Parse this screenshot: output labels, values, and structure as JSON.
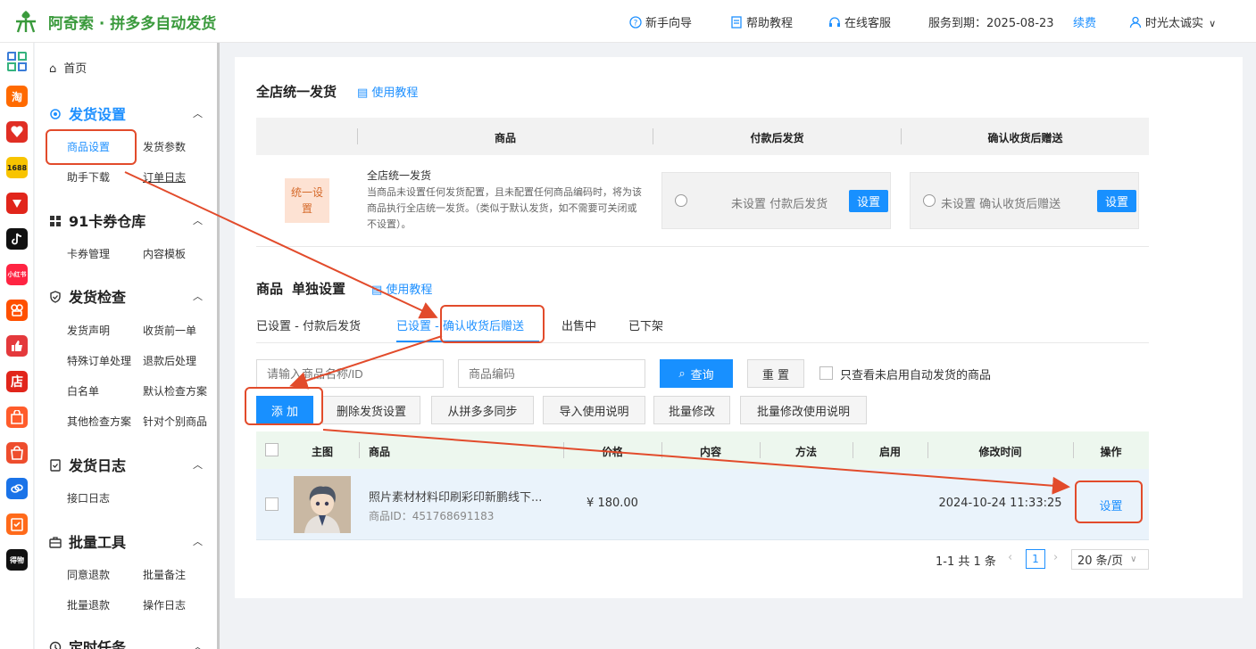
{
  "header": {
    "brand": "阿奇索 · 拼多多自动发货",
    "nav": [
      "新手向导",
      "帮助教程",
      "在线客服"
    ],
    "service_label": "服务到期：2025-08-23",
    "renew": "续费",
    "user": "时光太诚实"
  },
  "apps": [
    "淘",
    "",
    "",
    "",
    "",
    "小红书",
    "",
    "",
    "店",
    "",
    "",
    "",
    "",
    "得物"
  ],
  "sidebar": {
    "home": "首页",
    "sections": [
      {
        "title": "发货设置",
        "items": [
          "商品设置",
          "发货参数",
          "助手下载",
          "订单日志"
        ]
      },
      {
        "title": "91卡券仓库",
        "items": [
          "卡券管理",
          "内容模板"
        ]
      },
      {
        "title": "发货检查",
        "items": [
          "发货声明",
          "收货前一单",
          "特殊订单处理",
          "退款后处理",
          "白名单",
          "默认检查方案",
          "其他检查方案",
          "针对个别商品"
        ]
      },
      {
        "title": "发货日志",
        "items": [
          "接口日志"
        ]
      },
      {
        "title": "批量工具",
        "items": [
          "同意退款",
          "批量备注",
          "批量退款",
          "操作日志"
        ]
      },
      {
        "title": "定时任务",
        "items": []
      }
    ]
  },
  "store_section": {
    "title": "全店统一发货",
    "help": "使用教程",
    "columns": [
      "商品",
      "付款后发货",
      "确认收货后赠送"
    ],
    "badge": "统一设置",
    "row_title": "全店统一发货",
    "row_desc": "当商品未设置任何发货配置，且未配置任何商品编码时，将为该商品执行全店统一发货。（类似于默认发货，如不需要可关闭或不设置）。",
    "pay_status": "未设置 付款后发货",
    "confirm_status": "未设置 确认收货后赠送",
    "set_label": "设置"
  },
  "product_section": {
    "title_a": "商品",
    "title_b": "单独设置",
    "help": "使用教程",
    "tabs": [
      "已设置 - 付款后发货",
      "已设置 - 确认收货后赠送",
      "出售中",
      "已下架"
    ],
    "active_tab": "已设置 - 确认收货后赠送",
    "search_placeholder": "请输入商品名称/ID",
    "code_placeholder": "商品编码",
    "query": "查询",
    "reset": "重 置",
    "only_unenabled": "只查看未启用自动发货的商品",
    "actions": [
      "添 加",
      "删除发货设置",
      "从拼多多同步",
      "导入使用说明",
      "批量修改",
      "批量修改使用说明"
    ],
    "columns": [
      "主图",
      "商品",
      "价格",
      "内容",
      "方法",
      "启用",
      "修改时间",
      "操作"
    ],
    "rows": [
      {
        "name": "照片素材材料印刷彩印新鹏线下...",
        "id": "商品ID：451768691183",
        "price": "¥ 180.00",
        "time": "2024-10-24 11:33:25",
        "op": "设置"
      }
    ],
    "pagination": {
      "summary": "1-1 共 1 条",
      "page": "1",
      "page_size": "20 条/页"
    }
  },
  "colors": {
    "accent": "#1890ff",
    "brand": "#3a9a3c",
    "annotation": "#e24b2b"
  }
}
